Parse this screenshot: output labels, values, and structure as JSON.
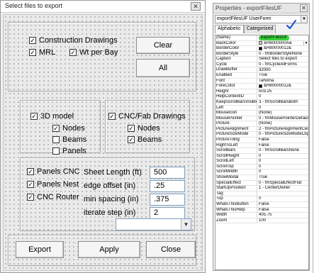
{
  "form": {
    "title": "Select files to export",
    "close_glyph": "✕",
    "check_glyph": "✓",
    "checkboxes": {
      "construction_drawings": {
        "label": "Construction Drawings",
        "checked": true
      },
      "mrl": {
        "label": "MRL",
        "checked": true
      },
      "wt_per_bay": {
        "label": "Wt per Bay",
        "checked": true
      },
      "model_3d": {
        "label": "3D model",
        "checked": true
      },
      "model_nodes": {
        "label": "Nodes",
        "checked": true
      },
      "model_beams": {
        "label": "Beams",
        "checked": false
      },
      "model_panels": {
        "label": "Panels",
        "checked": false
      },
      "cnc_fab": {
        "label": "CNC/Fab Drawings",
        "checked": true
      },
      "cnc_nodes": {
        "label": "Nodes",
        "checked": true
      },
      "cnc_beams": {
        "label": "Beams",
        "checked": true
      },
      "panels_cnc": {
        "label": "Panels CNC",
        "checked": true
      },
      "panels_nest": {
        "label": "Panels Nest",
        "checked": true
      },
      "cnc_router": {
        "label": "CNC Router",
        "checked": true
      }
    },
    "fields": {
      "sheet_length": {
        "label": "Sheet Length (ft)",
        "value": "500"
      },
      "edge_offset": {
        "label": "edge offset (in)",
        "value": ".25"
      },
      "min_spacing": {
        "label": "min spacing (in)",
        "value": ".375"
      },
      "iterate_step": {
        "label": "iterate step (in)",
        "value": "2"
      }
    },
    "combo_value": "",
    "combo_arrow": "▼",
    "buttons": {
      "clear": "Clear",
      "all": "All",
      "export": "Export",
      "apply": "Apply",
      "close": "Close"
    }
  },
  "properties": {
    "title": "Properties - exportFilesUF",
    "close_glyph": "✕",
    "object": "exportFilesUF UserForm",
    "tabs": [
      "Alphabetic",
      "Categorized"
    ],
    "active_tab": 0,
    "dropdown_glyph": "▼",
    "rows": [
      {
        "name": "(Name)",
        "value": "exportFilesUF",
        "selected": true
      },
      {
        "name": "BackColor",
        "value": "&H8000000A&",
        "swatch": "#d4d0c8",
        "dropdown": true
      },
      {
        "name": "BorderColor",
        "value": "&H80000012&",
        "swatch": "#000000"
      },
      {
        "name": "BorderStyle",
        "value": "0 - fmBorderStyleNone"
      },
      {
        "name": "Caption",
        "value": "Select files to export"
      },
      {
        "name": "Cycle",
        "value": "0 - fmCycleAllForms"
      },
      {
        "name": "DrawBuffer",
        "value": "32000"
      },
      {
        "name": "Enabled",
        "value": "True"
      },
      {
        "name": "Font",
        "value": "Tahoma"
      },
      {
        "name": "ForeColor",
        "value": "&H80000012&",
        "swatch": "#000000"
      },
      {
        "name": "Height",
        "value": "503.25"
      },
      {
        "name": "HelpContextID",
        "value": "0"
      },
      {
        "name": "KeepScrollBarsVisible",
        "value": "3 - fmScrollBarsBoth"
      },
      {
        "name": "Left",
        "value": "0"
      },
      {
        "name": "MouseIcon",
        "value": "(None)"
      },
      {
        "name": "MousePointer",
        "value": "0 - fmMousePointerDefault"
      },
      {
        "name": "Picture",
        "value": "(None)"
      },
      {
        "name": "PictureAlignment",
        "value": "2 - fmPictureAlignmentCenter"
      },
      {
        "name": "PictureSizeMode",
        "value": "0 - fmPictureSizeModeClip"
      },
      {
        "name": "PictureTiling",
        "value": "False"
      },
      {
        "name": "RightToLeft",
        "value": "False"
      },
      {
        "name": "ScrollBars",
        "value": "0 - fmScrollBarsNone"
      },
      {
        "name": "ScrollHeight",
        "value": "0"
      },
      {
        "name": "ScrollLeft",
        "value": "0"
      },
      {
        "name": "ScrollTop",
        "value": "0"
      },
      {
        "name": "ScrollWidth",
        "value": "0"
      },
      {
        "name": "ShowModal",
        "value": "True"
      },
      {
        "name": "SpecialEffect",
        "value": "0 - fmSpecialEffectFlat"
      },
      {
        "name": "StartUpPosition",
        "value": "1 - CenterOwner"
      },
      {
        "name": "Tag",
        "value": ""
      },
      {
        "name": "Top",
        "value": "0"
      },
      {
        "name": "WhatsThisButton",
        "value": "False"
      },
      {
        "name": "WhatsThisHelp",
        "value": "False"
      },
      {
        "name": "Width",
        "value": "405.75"
      },
      {
        "name": "Zoom",
        "value": "100"
      }
    ]
  },
  "colors": {
    "highlight": "#3cd23c",
    "annotation_check": "#1a4fd6"
  },
  "icons": {
    "annotation": "checkmark-icon"
  }
}
